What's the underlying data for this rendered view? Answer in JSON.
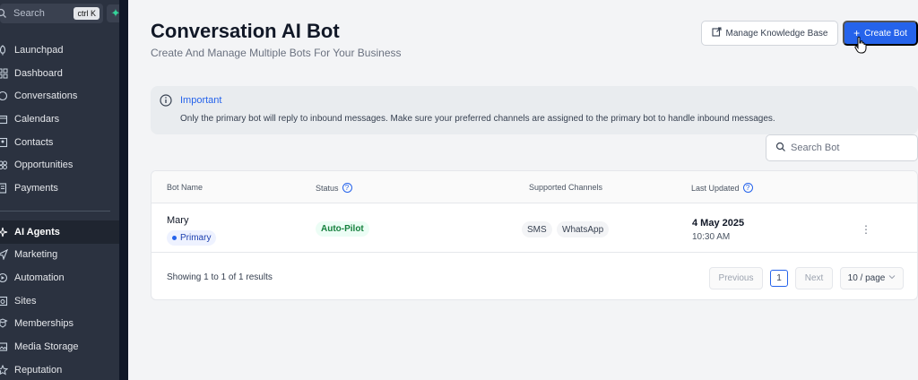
{
  "sidebar": {
    "search_placeholder": "Search",
    "search_shortcut": "ctrl K",
    "items_top": [
      {
        "label": "Launchpad",
        "icon": "rocket-icon"
      },
      {
        "label": "Dashboard",
        "icon": "grid-icon"
      },
      {
        "label": "Conversations",
        "icon": "chat-icon"
      },
      {
        "label": "Calendars",
        "icon": "calendar-icon"
      },
      {
        "label": "Contacts",
        "icon": "contacts-icon"
      },
      {
        "label": "Opportunities",
        "icon": "funnel-icon"
      },
      {
        "label": "Payments",
        "icon": "receipt-icon"
      }
    ],
    "items_bottom": [
      {
        "label": "AI Agents",
        "icon": "sparkle-icon",
        "active": true
      },
      {
        "label": "Marketing",
        "icon": "send-icon"
      },
      {
        "label": "Automation",
        "icon": "automation-icon"
      },
      {
        "label": "Sites",
        "icon": "sites-icon"
      },
      {
        "label": "Memberships",
        "icon": "memberships-icon"
      },
      {
        "label": "Media Storage",
        "icon": "image-icon"
      },
      {
        "label": "Reputation",
        "icon": "star-icon"
      }
    ]
  },
  "header": {
    "title": "Conversation AI Bot",
    "subtitle": "Create And Manage Multiple Bots For Your Business",
    "manage_kb_label": "Manage Knowledge Base",
    "create_bot_label": "Create Bot"
  },
  "notice": {
    "title": "Important",
    "text": "Only the primary bot will reply to inbound messages. Make sure your preferred channels are assigned to the primary bot to handle inbound messages."
  },
  "search_bot": {
    "placeholder": "Search Bot"
  },
  "table": {
    "columns": {
      "bot_name": "Bot Name",
      "status": "Status",
      "channels": "Supported Channels",
      "last_updated": "Last Updated"
    },
    "rows": [
      {
        "name": "Mary",
        "badge": "Primary",
        "status": "Auto-Pilot",
        "channels": [
          "SMS",
          "WhatsApp"
        ],
        "date": "4 May 2025",
        "time": "10:30 AM"
      }
    ],
    "footer": {
      "showing": "Showing 1 to 1 of 1 results",
      "previous": "Previous",
      "page": "1",
      "next": "Next",
      "per_page": "10 / page"
    }
  },
  "colors": {
    "sidebar_bg": "#2b3240",
    "accent": "#2563eb",
    "status_green": "#15803d"
  }
}
